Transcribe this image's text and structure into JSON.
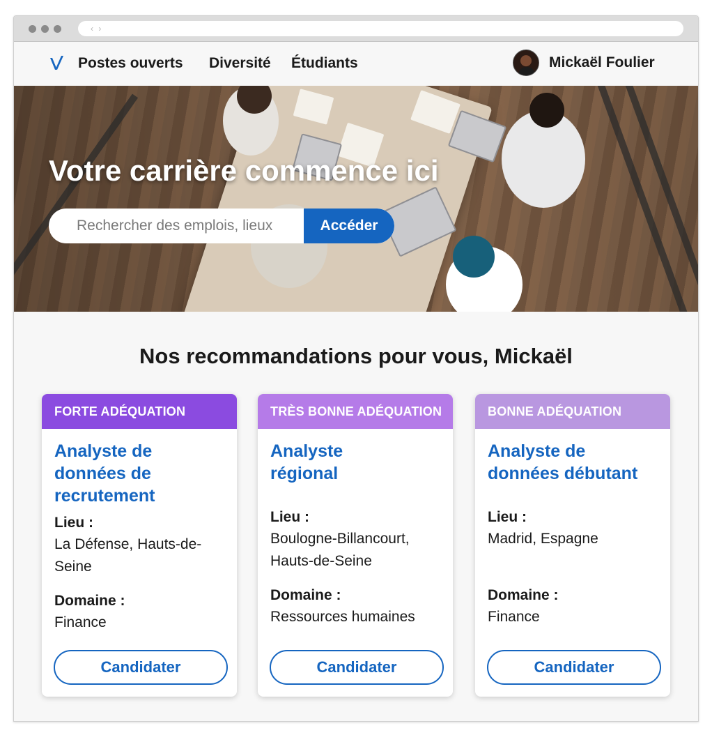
{
  "browser": {
    "url_glyph": "‹ ›"
  },
  "nav": {
    "links": [
      "Postes ouverts",
      "Diversité",
      "Étudiants"
    ],
    "user_name": "Mickaël Foulier"
  },
  "hero": {
    "title": "Votre carrière commence ici",
    "search_placeholder": "Rechercher des emplois, lieux",
    "search_button": "Accéder"
  },
  "recommendations": {
    "title": "Nos recommandations pour vous, Mickaël",
    "location_label": "Lieu :",
    "domain_label": "Domaine :",
    "apply_label": "Candidater",
    "cards": [
      {
        "badge": "FORTE ADÉQUATION",
        "badge_color": "#8b4be0",
        "title": "Analyste de données de recrutement",
        "location": "La Défense, Hauts-de-Seine",
        "domain": "Finance"
      },
      {
        "badge": "TRÈS BONNE ADÉQUATION",
        "badge_color": "#b57be8",
        "title": "Analyste régional",
        "location": "Boulogne-Billancourt, Hauts-de-Seine",
        "domain": "Ressources humaines"
      },
      {
        "badge": "BONNE ADÉQUATION",
        "badge_color": "#b997e0",
        "title": "Analyste de données débutant",
        "location": "Madrid, Espagne",
        "domain": "Finance"
      }
    ]
  },
  "colors": {
    "accent": "#1565c0",
    "logo": "#1565c0"
  }
}
